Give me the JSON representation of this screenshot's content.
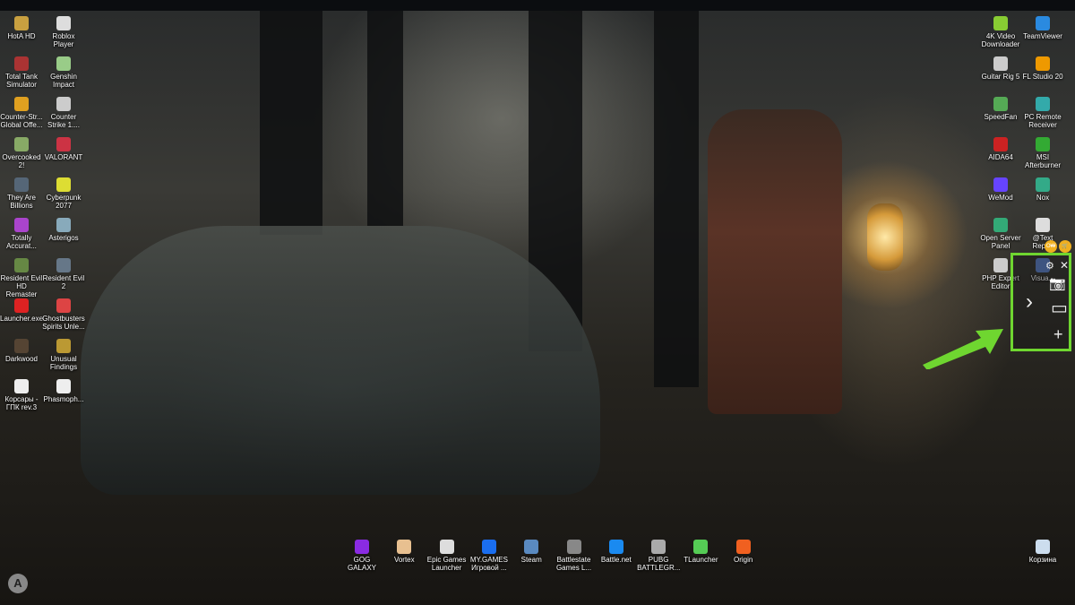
{
  "desktop_icons_left": [
    {
      "label": "HotA HD",
      "color": "#c8a040"
    },
    {
      "label": "Roblox Player",
      "color": "#ddd"
    },
    {
      "label": "Total Tank Simulator",
      "color": "#a33"
    },
    {
      "label": "Genshin Impact",
      "color": "#9c8"
    },
    {
      "label": "Counter-Str... Global Offe...",
      "color": "#e0a020"
    },
    {
      "label": "Counter Strike 1....",
      "color": "#ccc"
    },
    {
      "label": "Overcooked 2!",
      "color": "#8a6"
    },
    {
      "label": "VALORANT",
      "color": "#c34"
    },
    {
      "label": "They Are Billions",
      "color": "#567"
    },
    {
      "label": "Cyberpunk 2077",
      "color": "#dd3"
    },
    {
      "label": "Totally Accurat...",
      "color": "#a4c"
    },
    {
      "label": "Asterigos",
      "color": "#8ab"
    },
    {
      "label": "Resident Evil HD Remaster",
      "color": "#684"
    },
    {
      "label": "Resident Evil 2",
      "color": "#678"
    },
    {
      "label": "Launcher.exe",
      "color": "#d22"
    },
    {
      "label": "Ghostbusters Spirits Unle...",
      "color": "#d44"
    },
    {
      "label": "Darkwood",
      "color": "#543"
    },
    {
      "label": "Unusual Findings",
      "color": "#b93"
    },
    {
      "label": "Корсары - ГПК rev.3",
      "color": "#eee"
    },
    {
      "label": "Phasmoph...",
      "color": "#eee"
    }
  ],
  "desktop_icons_right": [
    {
      "label": "4K Video Downloader",
      "color": "#8c3"
    },
    {
      "label": "TeamViewer",
      "color": "#2a8ae0"
    },
    {
      "label": "Guitar Rig 5",
      "color": "#ccc"
    },
    {
      "label": "FL Studio 20",
      "color": "#e90"
    },
    {
      "label": "SpeedFan",
      "color": "#5a5"
    },
    {
      "label": "PC Remote Receiver",
      "color": "#3aa"
    },
    {
      "label": "AIDA64",
      "color": "#c22"
    },
    {
      "label": "MSI Afterburner",
      "color": "#3a3"
    },
    {
      "label": "WeMod",
      "color": "#64f"
    },
    {
      "label": "Nox",
      "color": "#3a8"
    },
    {
      "label": "Open Server Panel",
      "color": "#3a7"
    },
    {
      "label": "@Text Repl...",
      "color": "#ddd"
    },
    {
      "label": "PHP Expert Editor",
      "color": "#ccc"
    },
    {
      "label": "Visua...",
      "color": "#57b"
    }
  ],
  "taskbar_row_icons": [
    {
      "label": "GOG GALAXY",
      "color": "#8a2be2"
    },
    {
      "label": "Vortex",
      "color": "#e8c090"
    },
    {
      "label": "Epic Games Launcher",
      "color": "#ddd"
    },
    {
      "label": "MY.GAMES Игровой ...",
      "color": "#1a6ef0"
    },
    {
      "label": "Steam",
      "color": "#5a8ac0"
    },
    {
      "label": "Battlestate Games L...",
      "color": "#888"
    },
    {
      "label": "Battle.net",
      "color": "#1a8af0"
    },
    {
      "label": "PUBG BATTLEGR...",
      "color": "#aaa"
    },
    {
      "label": "TLauncher",
      "color": "#5c5"
    },
    {
      "label": "Origin",
      "color": "#f06020"
    }
  ],
  "recycle_bin": {
    "label": "Корзина",
    "color": "#cde"
  },
  "widget": {
    "settings": "⚙",
    "close": "✕",
    "expand": "›",
    "screenshot": "📷",
    "record": "▭",
    "add": "+",
    "coins": [
      "O₩",
      "🛒"
    ],
    "accent": "#6fd630"
  },
  "logo": "A"
}
